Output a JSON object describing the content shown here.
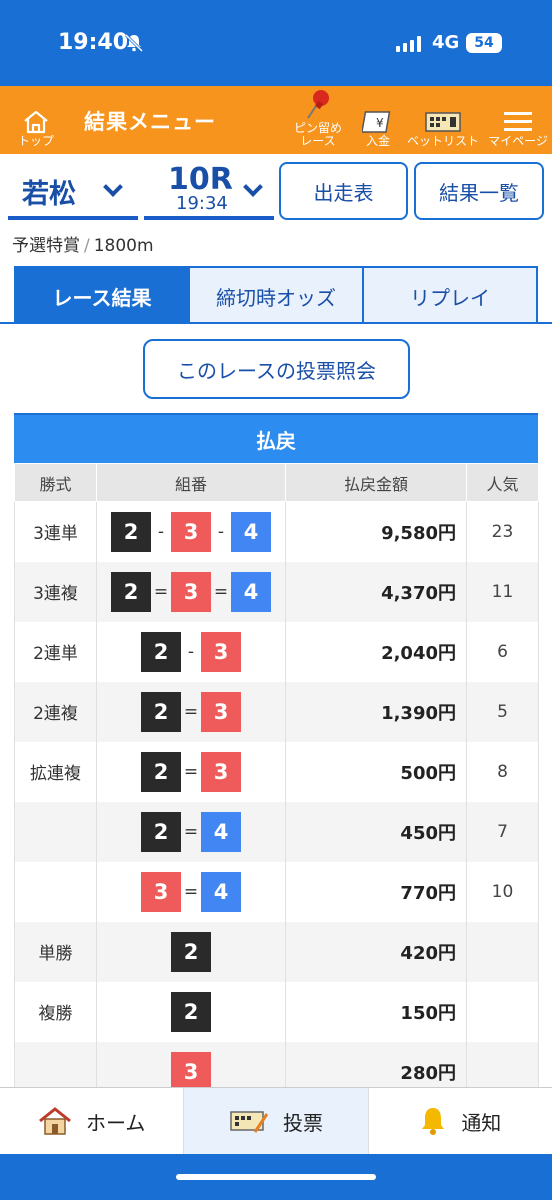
{
  "status_bar": {
    "time": "19:40",
    "network": "4G",
    "battery": "54"
  },
  "header": {
    "top_label": "トップ",
    "title": "結果メニュー",
    "pin_label": "ピン留め\nレース",
    "deposit_label": "入金",
    "betlist_label": "ベットリスト",
    "mypage_label": "マイページ"
  },
  "race_selector": {
    "venue": "若松",
    "race_number": "10R",
    "race_time": "19:34",
    "entry_button": "出走表",
    "results_list_button": "結果一覧"
  },
  "race_info": {
    "race_name": "予選特賞",
    "separator": "/",
    "distance": "1800m"
  },
  "tabs": [
    {
      "label": "レース結果",
      "active": true
    },
    {
      "label": "締切時オッズ",
      "active": false
    },
    {
      "label": "リプレイ",
      "active": false
    }
  ],
  "query_button": "このレースの投票照会",
  "payout": {
    "title": "払戻",
    "headers": [
      "勝式",
      "組番",
      "払戻金額",
      "人気"
    ],
    "rows": [
      {
        "type": "3連単",
        "boats": [
          "2",
          "3",
          "4"
        ],
        "op": "-",
        "amount": "9,580円",
        "popularity": "23"
      },
      {
        "type": "3連複",
        "boats": [
          "2",
          "3",
          "4"
        ],
        "op": "=",
        "amount": "4,370円",
        "popularity": "11"
      },
      {
        "type": "2連単",
        "boats": [
          "2",
          "3"
        ],
        "op": "-",
        "amount": "2,040円",
        "popularity": "6"
      },
      {
        "type": "2連複",
        "boats": [
          "2",
          "3"
        ],
        "op": "=",
        "amount": "1,390円",
        "popularity": "5"
      },
      {
        "type": "拡連複",
        "boats": [
          "2",
          "3"
        ],
        "op": "=",
        "amount": "500円",
        "popularity": "8"
      },
      {
        "type": "",
        "boats": [
          "2",
          "4"
        ],
        "op": "=",
        "amount": "450円",
        "popularity": "7"
      },
      {
        "type": "",
        "boats": [
          "3",
          "4"
        ],
        "op": "=",
        "amount": "770円",
        "popularity": "10"
      },
      {
        "type": "単勝",
        "boats": [
          "2"
        ],
        "op": "",
        "amount": "420円",
        "popularity": ""
      },
      {
        "type": "複勝",
        "boats": [
          "2"
        ],
        "op": "",
        "amount": "150円",
        "popularity": ""
      },
      {
        "type": "",
        "boats": [
          "3"
        ],
        "op": "",
        "amount": "280円",
        "popularity": ""
      }
    ]
  },
  "bottom_nav": [
    {
      "label": "ホーム",
      "icon": "home-icon",
      "active": false
    },
    {
      "label": "投票",
      "icon": "bet-ticket-icon",
      "active": true
    },
    {
      "label": "通知",
      "icon": "bell-icon",
      "active": false
    }
  ],
  "colors": {
    "brand_blue": "#1a6fd4",
    "header_orange": "#f7941d",
    "boat_2": "#2a2a2a",
    "boat_3": "#ef5a5a",
    "boat_4": "#4286f4"
  }
}
